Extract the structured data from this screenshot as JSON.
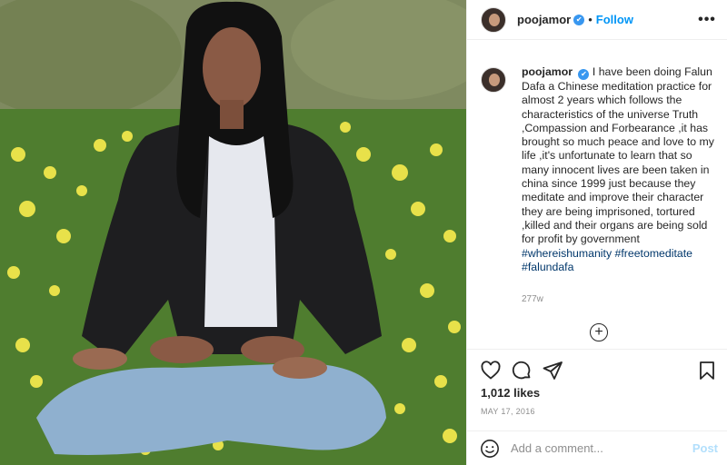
{
  "post": {
    "username": "poojamor",
    "verified_mark": "✔",
    "separator": "•",
    "follow_label": "Follow",
    "more_label": "•••",
    "caption_text": "I have been doing Falun Dafa a Chinese meditation practice for almost 2 years which follows the characteristics of the universe Truth ,Compassion and Forbearance ,it has brought so much peace and love to my life ,it's unfortunate to learn that so many innocent lives are been taken in china since 1999 just because they meditate and improve their character they are being imprisoned, tortured ,killed and their organs are being sold for profit by government",
    "hashtags": [
      "#whereishumanity",
      "#freetomeditate",
      "#falundafa"
    ],
    "age": "277w",
    "load_more_label": "+",
    "likes": "1,012 likes",
    "date": "MAY 17, 2016",
    "comment_placeholder": "Add a comment...",
    "post_label": "Post"
  },
  "icons": {
    "like": "heart-icon",
    "comment": "comment-icon",
    "share": "share-icon",
    "save": "bookmark-icon",
    "emoji": "emoji-icon"
  },
  "colors": {
    "accent": "#0095f6",
    "verified": "#3897f0",
    "hashtag": "#00376b",
    "muted": "#8e8e8e",
    "post_disabled": "#b2dffc"
  }
}
